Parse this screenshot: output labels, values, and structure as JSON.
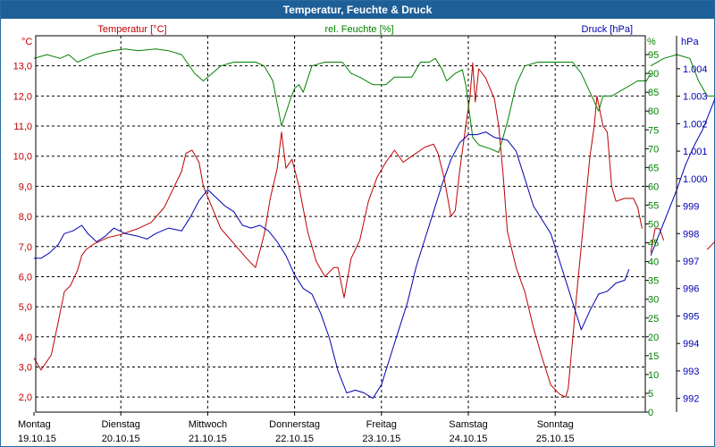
{
  "window": {
    "title": "Temperatur, Feuchte & Druck"
  },
  "chart_data": {
    "type": "line",
    "title": "Temperatur, Feuchte & Druck",
    "grid": true,
    "x_ticks": [
      {
        "day": "Montag",
        "date": "19.10.15"
      },
      {
        "day": "Dienstag",
        "date": "20.10.15"
      },
      {
        "day": "Mittwoch",
        "date": "21.10.15"
      },
      {
        "day": "Donnerstag",
        "date": "22.10.15"
      },
      {
        "day": "Freitag",
        "date": "23.10.15"
      },
      {
        "day": "Samstag",
        "date": "24.10.15"
      },
      {
        "day": "Sonntag",
        "date": "25.10.15"
      }
    ],
    "x_range_days": [
      0,
      7.25
    ],
    "axes": {
      "temperature": {
        "label": "Temperatur [°C]",
        "unit": "°C",
        "range": [
          1.5,
          14.0
        ],
        "ticks": [
          "2,0",
          "3,0",
          "4,0",
          "5,0",
          "6,0",
          "7,0",
          "8,0",
          "9,0",
          "10,0",
          "11,0",
          "12,0",
          "13,0"
        ],
        "color": "#c00000"
      },
      "humidity": {
        "label": "rel. Feuchte [%]",
        "unit": "%",
        "range": [
          0,
          100
        ],
        "ticks": [
          "0",
          "5",
          "10",
          "15",
          "20",
          "25",
          "30",
          "35",
          "40",
          "45",
          "50",
          "55",
          "60",
          "65",
          "70",
          "75",
          "80",
          "85",
          "90",
          "95"
        ],
        "color": "#008000"
      },
      "pressure": {
        "label": "Druck [hPa]",
        "unit": "hPa",
        "range": [
          991.5,
          1005.2
        ],
        "ticks": [
          "992",
          "993",
          "994",
          "995",
          "996",
          "997",
          "998",
          "999",
          "1.000",
          "1.001",
          "1.002",
          "1.003",
          "1.004"
        ],
        "color": "#0000b0"
      }
    },
    "series": [
      {
        "name": "Temperatur [°C]",
        "axis": "temperature",
        "color": "#c00000",
        "segments": [
          [
            [
              0,
              3.3
            ],
            [
              0.08,
              2.9
            ],
            [
              0.2,
              3.4
            ],
            [
              0.28,
              4.5
            ],
            [
              0.35,
              5.5
            ],
            [
              0.42,
              5.7
            ],
            [
              0.5,
              6.2
            ],
            [
              0.55,
              6.7
            ],
            [
              0.6,
              6.9
            ],
            [
              0.7,
              7.1
            ],
            [
              0.85,
              7.3
            ],
            [
              1.0,
              7.4
            ],
            [
              1.2,
              7.6
            ],
            [
              1.35,
              7.8
            ],
            [
              1.5,
              8.3
            ],
            [
              1.6,
              8.9
            ],
            [
              1.7,
              9.5
            ],
            [
              1.75,
              10.1
            ],
            [
              1.82,
              10.2
            ],
            [
              1.9,
              9.8
            ],
            [
              1.95,
              9.0
            ],
            [
              2.05,
              8.3
            ],
            [
              2.15,
              7.6
            ],
            [
              2.3,
              7.1
            ],
            [
              2.45,
              6.6
            ],
            [
              2.55,
              6.3
            ],
            [
              2.65,
              7.4
            ],
            [
              2.72,
              8.6
            ],
            [
              2.8,
              9.6
            ],
            [
              2.85,
              10.8
            ],
            [
              2.9,
              9.6
            ],
            [
              2.97,
              9.9
            ],
            [
              3.05,
              9.0
            ],
            [
              3.15,
              7.5
            ],
            [
              3.25,
              6.5
            ],
            [
              3.35,
              6.0
            ],
            [
              3.45,
              6.3
            ],
            [
              3.5,
              6.3
            ],
            [
              3.57,
              5.3
            ],
            [
              3.65,
              6.6
            ],
            [
              3.75,
              7.2
            ],
            [
              3.85,
              8.5
            ],
            [
              3.95,
              9.3
            ],
            [
              4.05,
              9.8
            ],
            [
              4.15,
              10.2
            ],
            [
              4.25,
              9.8
            ],
            [
              4.35,
              10.0
            ],
            [
              4.5,
              10.3
            ],
            [
              4.6,
              10.4
            ],
            [
              4.65,
              10.1
            ],
            [
              4.72,
              9.3
            ],
            [
              4.8,
              8.0
            ],
            [
              4.85,
              8.2
            ],
            [
              4.9,
              9.5
            ],
            [
              4.97,
              11.0
            ],
            [
              5.02,
              12.0
            ],
            [
              5.05,
              13.1
            ],
            [
              5.08,
              11.8
            ],
            [
              5.12,
              12.9
            ],
            [
              5.2,
              12.6
            ],
            [
              5.3,
              11.9
            ],
            [
              5.35,
              11.0
            ],
            [
              5.4,
              9.4
            ],
            [
              5.45,
              7.5
            ],
            [
              5.55,
              6.3
            ],
            [
              5.65,
              5.5
            ],
            [
              5.75,
              4.3
            ],
            [
              5.85,
              3.3
            ],
            [
              5.95,
              2.4
            ],
            [
              6.05,
              2.1
            ],
            [
              6.12,
              2.0
            ],
            [
              6.15,
              2.3
            ],
            [
              6.25,
              5.5
            ],
            [
              6.35,
              8.5
            ],
            [
              6.4,
              10.0
            ],
            [
              6.45,
              11.0
            ],
            [
              6.48,
              12.0
            ],
            [
              6.55,
              11.0
            ],
            [
              6.6,
              10.8
            ],
            [
              6.65,
              9.0
            ],
            [
              6.7,
              8.5
            ],
            [
              6.8,
              8.6
            ],
            [
              6.9,
              8.6
            ],
            [
              6.95,
              8.3
            ],
            [
              7.0,
              7.6
            ]
          ],
          [
            [
              7.1,
              6.8
            ],
            [
              7.15,
              7.6
            ],
            [
              7.2,
              7.6
            ],
            [
              7.25,
              7.2
            ]
          ],
          [
            [
              7.75,
              6.9
            ],
            [
              7.85,
              7.2
            ],
            [
              7.95,
              7.5
            ],
            [
              8.0,
              7.8
            ],
            [
              8.05,
              6.8
            ],
            [
              8.15,
              6.0
            ]
          ]
        ]
      },
      {
        "name": "rel. Feuchte [%]",
        "axis": "humidity",
        "color": "#008000",
        "segments": [
          [
            [
              0,
              94
            ],
            [
              0.15,
              95
            ],
            [
              0.3,
              94
            ],
            [
              0.4,
              95
            ],
            [
              0.5,
              93
            ],
            [
              0.6,
              94
            ],
            [
              0.7,
              95
            ],
            [
              0.9,
              96
            ],
            [
              1.05,
              96.5
            ],
            [
              1.2,
              96
            ],
            [
              1.4,
              96.5
            ],
            [
              1.55,
              96
            ],
            [
              1.7,
              95
            ],
            [
              1.85,
              90
            ],
            [
              1.95,
              88
            ],
            [
              2.05,
              90
            ],
            [
              2.15,
              92
            ],
            [
              2.3,
              93
            ],
            [
              2.45,
              93
            ],
            [
              2.55,
              93
            ],
            [
              2.65,
              92
            ],
            [
              2.75,
              88
            ],
            [
              2.85,
              76
            ],
            [
              2.95,
              83
            ],
            [
              3.0,
              86
            ],
            [
              3.05,
              87
            ],
            [
              3.1,
              85
            ],
            [
              3.2,
              92
            ],
            [
              3.35,
              93
            ],
            [
              3.45,
              93
            ],
            [
              3.55,
              93
            ],
            [
              3.65,
              90
            ],
            [
              3.75,
              89
            ],
            [
              3.9,
              87
            ],
            [
              4.05,
              87
            ],
            [
              4.15,
              89
            ],
            [
              4.25,
              89
            ],
            [
              4.35,
              89
            ],
            [
              4.45,
              93
            ],
            [
              4.55,
              93
            ],
            [
              4.62,
              94
            ],
            [
              4.7,
              91
            ],
            [
              4.75,
              88
            ],
            [
              4.85,
              90
            ],
            [
              4.93,
              91
            ],
            [
              4.97,
              87
            ],
            [
              5.05,
              73
            ],
            [
              5.12,
              71
            ],
            [
              5.25,
              70
            ],
            [
              5.35,
              69
            ],
            [
              5.45,
              77
            ],
            [
              5.55,
              87
            ],
            [
              5.65,
              92
            ],
            [
              5.8,
              93
            ],
            [
              5.95,
              93
            ],
            [
              6.1,
              93
            ],
            [
              6.2,
              93
            ],
            [
              6.3,
              90
            ],
            [
              6.4,
              85
            ],
            [
              6.5,
              80
            ],
            [
              6.55,
              84
            ],
            [
              6.65,
              84
            ],
            [
              6.8,
              86
            ],
            [
              6.95,
              88
            ],
            [
              7.05,
              88
            ],
            [
              7.1,
              90
            ]
          ],
          [
            [
              7.1,
              92
            ],
            [
              7.25,
              94
            ],
            [
              7.4,
              95
            ],
            [
              7.55,
              94
            ],
            [
              7.65,
              88
            ],
            [
              7.75,
              84
            ],
            [
              7.85,
              84
            ],
            [
              7.9,
              87
            ],
            [
              7.95,
              90
            ],
            [
              8.05,
              94
            ],
            [
              8.15,
              93
            ]
          ]
        ]
      },
      {
        "name": "Druck [hPa]",
        "axis": "pressure",
        "color": "#0000b0",
        "segments": [
          [
            [
              0,
              997.1
            ],
            [
              0.08,
              997.1
            ],
            [
              0.18,
              997.3
            ],
            [
              0.28,
              997.6
            ],
            [
              0.35,
              998.0
            ],
            [
              0.45,
              998.1
            ],
            [
              0.55,
              998.3
            ],
            [
              0.62,
              998.0
            ],
            [
              0.72,
              997.7
            ],
            [
              0.82,
              997.9
            ],
            [
              0.92,
              998.2
            ],
            [
              1.05,
              998.0
            ],
            [
              1.2,
              997.9
            ],
            [
              1.3,
              997.8
            ],
            [
              1.4,
              998.0
            ],
            [
              1.55,
              998.2
            ],
            [
              1.7,
              998.1
            ],
            [
              1.8,
              998.6
            ],
            [
              1.9,
              999.2
            ],
            [
              2.0,
              999.6
            ],
            [
              2.1,
              999.3
            ],
            [
              2.2,
              999.0
            ],
            [
              2.3,
              998.8
            ],
            [
              2.4,
              998.3
            ],
            [
              2.5,
              998.2
            ],
            [
              2.6,
              998.3
            ],
            [
              2.7,
              998.1
            ],
            [
              2.8,
              997.7
            ],
            [
              2.9,
              997.2
            ],
            [
              3.0,
              996.5
            ],
            [
              3.1,
              996.0
            ],
            [
              3.2,
              995.8
            ],
            [
              3.3,
              995.1
            ],
            [
              3.4,
              994.2
            ],
            [
              3.5,
              993.0
            ],
            [
              3.6,
              992.2
            ],
            [
              3.7,
              992.3
            ],
            [
              3.8,
              992.2
            ],
            [
              3.9,
              992.0
            ],
            [
              4.0,
              992.5
            ],
            [
              4.1,
              993.5
            ],
            [
              4.2,
              994.5
            ],
            [
              4.3,
              995.5
            ],
            [
              4.4,
              996.8
            ],
            [
              4.5,
              997.8
            ],
            [
              4.6,
              998.8
            ],
            [
              4.7,
              999.8
            ],
            [
              4.8,
              1000.7
            ],
            [
              4.9,
              1001.3
            ],
            [
              5.0,
              1001.6
            ],
            [
              5.1,
              1001.6
            ],
            [
              5.2,
              1001.7
            ],
            [
              5.3,
              1001.5
            ],
            [
              5.45,
              1001.4
            ],
            [
              5.55,
              1001.0
            ],
            [
              5.65,
              1000.0
            ],
            [
              5.75,
              999.0
            ],
            [
              5.85,
              998.5
            ],
            [
              5.95,
              998.0
            ],
            [
              6.05,
              997.0
            ],
            [
              6.15,
              996.0
            ],
            [
              6.25,
              995.0
            ],
            [
              6.3,
              994.5
            ],
            [
              6.4,
              995.2
            ],
            [
              6.5,
              995.8
            ],
            [
              6.6,
              995.9
            ],
            [
              6.7,
              996.2
            ],
            [
              6.8,
              996.3
            ],
            [
              6.85,
              996.7
            ]
          ],
          [
            [
              7.1,
              997.2
            ],
            [
              7.2,
              998.0
            ],
            [
              7.3,
              998.8
            ],
            [
              7.4,
              999.6
            ],
            [
              7.5,
              1000.5
            ],
            [
              7.6,
              1001.2
            ],
            [
              7.7,
              1001.8
            ],
            [
              7.8,
              1002.6
            ],
            [
              7.9,
              1003.4
            ],
            [
              8.0,
              1003.8
            ],
            [
              8.05,
              1004.1
            ],
            [
              8.1,
              1004.4
            ],
            [
              8.15,
              1004.1
            ]
          ]
        ]
      }
    ]
  }
}
